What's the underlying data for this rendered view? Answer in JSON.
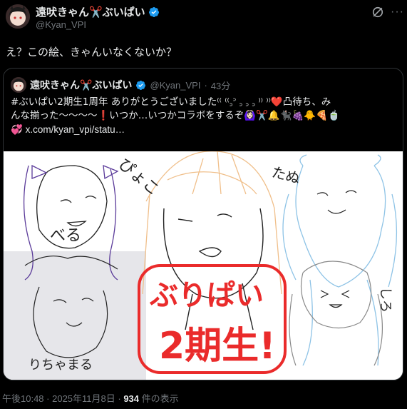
{
  "author": {
    "name": "遠吠きゃん✂️ぶいぱい",
    "handle": "@Kyan_VPI"
  },
  "post": {
    "text": "え？この絵、きゃんいなくないか？"
  },
  "quote": {
    "name": "遠吠きゃん✂️ぶいぱい",
    "handle": "@Kyan_VPI",
    "separator": "·",
    "time": "43分",
    "text_line1": "#ぶいぱい2期生1周年 ありがとうございました⁽⁽ ⁽⁽꜆꜄ ꜆ ꜆ ꜆ ⁾⁾ ⁾⁾❤️凸待ち、み",
    "text_line2": "んな揃った〜〜〜〜❗いつか…いつかコラボをするぞ🙆🏻‍♀️✂️🔔🐈‍⬛🍇🐥🍕🍵",
    "link_emoji": "💞",
    "link": "x.com/kyan_vpi/statu…",
    "drawing": {
      "labels": {
        "pyoko": "ぴょこ",
        "bell": "べる",
        "tanu": "たぬ",
        "riche": "りちゃまる",
        "shiro": "しろ",
        "vpi": "ぶりぱい",
        "gen": "2期生!"
      }
    }
  },
  "footer": {
    "time": "午後10:48",
    "sep1": " · ",
    "date": "2025年11月8日",
    "sep2": " · ",
    "views": "934",
    "views_label": " 件の表示"
  },
  "colors": {
    "background": "#000000",
    "text": "#e7e9ea",
    "muted": "#71767b",
    "border": "#2f3336",
    "verified": "#1d9bf0"
  },
  "icons": [
    "verified-badge-icon",
    "grok-icon",
    "more-icon"
  ]
}
